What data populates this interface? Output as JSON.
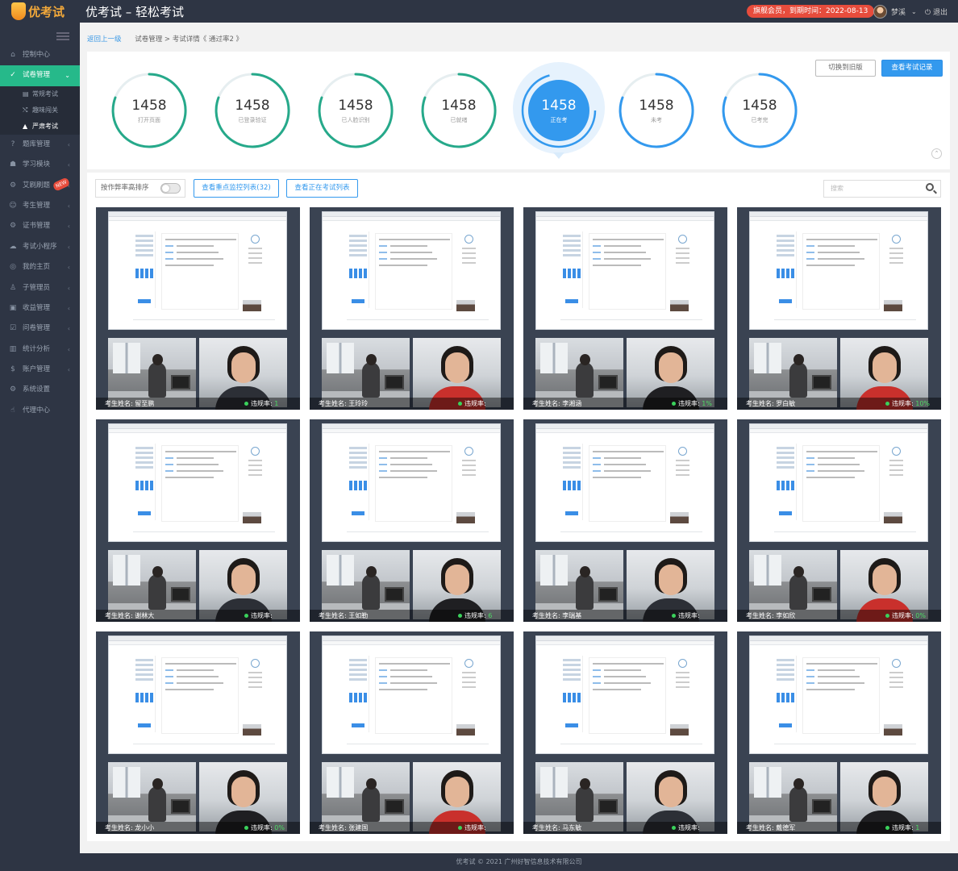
{
  "header": {
    "logo_text": "优考试",
    "title": "优考试 – 轻松考试",
    "vip": "旗舰会员，到期时间：2022-08-13",
    "user_name": "梦溪",
    "logout": "退出"
  },
  "sidebar": {
    "items": [
      {
        "label": "控制中心",
        "icon": "home-icon",
        "glyph": "⌂"
      },
      {
        "label": "试卷管理",
        "icon": "check-circle-icon",
        "glyph": "✓",
        "active": true
      },
      {
        "label": "题库管理",
        "icon": "question-icon",
        "glyph": "?"
      },
      {
        "label": "学习模块",
        "icon": "graduation-icon",
        "glyph": "☗"
      },
      {
        "label": "艾刷刷题",
        "icon": "gear-icon",
        "glyph": "⚙",
        "badge": "NEW"
      },
      {
        "label": "考生管理",
        "icon": "user-icon",
        "glyph": "☺"
      },
      {
        "label": "证书管理",
        "icon": "settings-icon",
        "glyph": "⚙"
      },
      {
        "label": "考试小程序",
        "icon": "chat-icon",
        "glyph": "☁"
      },
      {
        "label": "我的主页",
        "icon": "globe-icon",
        "glyph": "◎"
      },
      {
        "label": "子管理员",
        "icon": "admin-icon",
        "glyph": "♙"
      },
      {
        "label": "收益管理",
        "icon": "money-icon",
        "glyph": "▣"
      },
      {
        "label": "问卷管理",
        "icon": "form-icon",
        "glyph": "☑"
      },
      {
        "label": "统计分析",
        "icon": "chart-icon",
        "glyph": "▥"
      },
      {
        "label": "账户管理",
        "icon": "dollar-icon",
        "glyph": "$"
      },
      {
        "label": "系统设置",
        "icon": "cog-icon",
        "glyph": "⚙"
      },
      {
        "label": "代理中心",
        "icon": "thumb-icon",
        "glyph": "☝"
      }
    ],
    "sub_items": [
      {
        "label": "常规考试",
        "icon": "doc-icon",
        "glyph": "▤"
      },
      {
        "label": "趣味闯关",
        "icon": "shuffle-icon",
        "glyph": "⤭"
      },
      {
        "label": "严肃考试",
        "icon": "warning-icon",
        "glyph": "▲"
      }
    ]
  },
  "breadcrumb": {
    "back": "返回上一级",
    "path": "试卷管理 > 考试详情《 通过率2 》"
  },
  "stats": [
    {
      "value": "1458",
      "label": "打开页面",
      "color": "#26a98a"
    },
    {
      "value": "1458",
      "label": "已登录验证",
      "color": "#26a98a"
    },
    {
      "value": "1458",
      "label": "已人脸识别",
      "color": "#26a98a"
    },
    {
      "value": "1458",
      "label": "已就绪",
      "color": "#26a98a"
    },
    {
      "value": "1458",
      "label": "正在考",
      "color": "#3399ee"
    },
    {
      "value": "1458",
      "label": "未考",
      "color": "#3399ee"
    },
    {
      "value": "1458",
      "label": "已考完",
      "color": "#3399ee"
    }
  ],
  "buttons": {
    "switch_old": "切换到旧版",
    "view_records": "查看考试记录",
    "sort_label": "按作弊率高排序",
    "focus_list": "查看重点监控列表(32)",
    "ongoing_list": "查看正在考试列表",
    "search_placeholder": "搜索"
  },
  "candidates": [
    {
      "name": "考生姓名: 留至鹏",
      "rate_label": "违规率:",
      "rate_value": "1"
    },
    {
      "name": "考生姓名: 王玲玲",
      "rate_label": "违规率:",
      "rate_value": ""
    },
    {
      "name": "考生姓名: 李湘涵",
      "rate_label": "违规率:",
      "rate_value": "1%"
    },
    {
      "name": "考生姓名: 罗白敏",
      "rate_label": "违规率:",
      "rate_value": "10%"
    },
    {
      "name": "考生姓名: 谢林大",
      "rate_label": "违规率:",
      "rate_value": ""
    },
    {
      "name": "考生姓名: 王如勒",
      "rate_label": "违规率:",
      "rate_value": "6"
    },
    {
      "name": "考生姓名: 李瑞基",
      "rate_label": "违规率:",
      "rate_value": ""
    },
    {
      "name": "考生姓名: 李如欣",
      "rate_label": "违规率:",
      "rate_value": "0%"
    },
    {
      "name": "考生姓名: 龙小小",
      "rate_label": "违规率:",
      "rate_value": "0%"
    },
    {
      "name": "考生姓名: 张建国",
      "rate_label": "违规率:",
      "rate_value": ""
    },
    {
      "name": "考生姓名: 马东敏",
      "rate_label": "违规率:",
      "rate_value": ""
    },
    {
      "name": "考生姓名: 戴德军",
      "rate_label": "违规率:",
      "rate_value": "1"
    }
  ],
  "footer": "优考试 © 2021 广州好智信息技术有限公司"
}
